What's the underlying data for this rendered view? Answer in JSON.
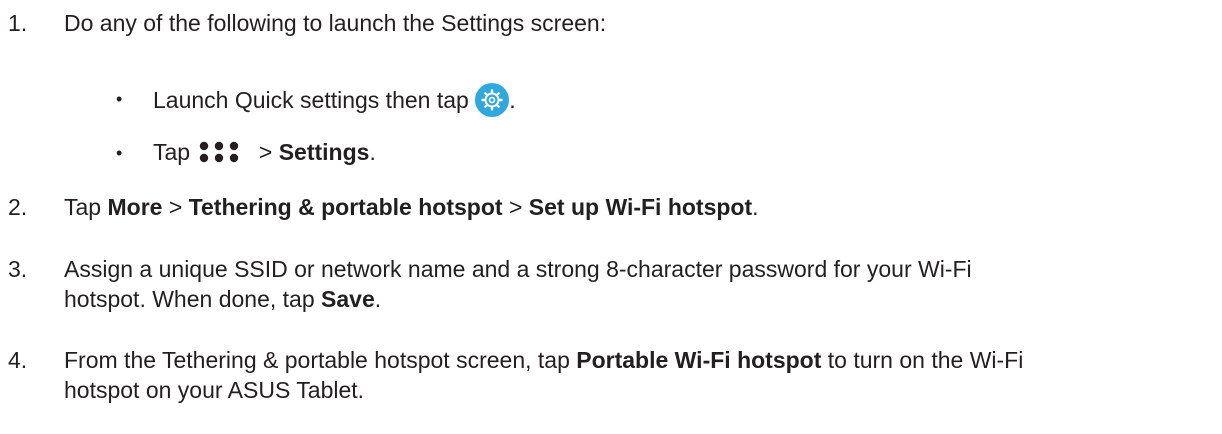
{
  "steps": [
    {
      "number": "1.",
      "text": "Do any of the following to launch the Settings screen:"
    },
    {
      "number": "2.",
      "pre": "Tap ",
      "b1": "More",
      "sep1": " > ",
      "b2": "Tethering & portable hotspot",
      "sep2": " > ",
      "b3": "Set up Wi-Fi hotspot",
      "post": "."
    },
    {
      "number": "3.",
      "line1": "Assign a unique SSID or network name and a strong 8-character password for your Wi-Fi",
      "line2_pre": "hotspot. When done, tap ",
      "line2_bold": "Save",
      "line2_post": "."
    },
    {
      "number": "4.",
      "line1_pre": "From the Tethering & portable hotspot screen, tap ",
      "line1_bold": "Portable Wi-Fi hotspot",
      "line1_post": " to turn on the Wi-Fi",
      "line2": "hotspot on your ASUS Tablet."
    }
  ],
  "substeps": [
    {
      "bullet": "•",
      "text": "Launch Quick settings then tap ",
      "icon": "settings-gear-icon",
      "post": "."
    },
    {
      "bullet": "•",
      "pre": "Tap ",
      "icon": "all-apps-icon",
      "mid": " > ",
      "bold": "Settings",
      "post": "."
    }
  ],
  "colors": {
    "icon_accent": "#2ea8df",
    "text": "#231f20"
  }
}
